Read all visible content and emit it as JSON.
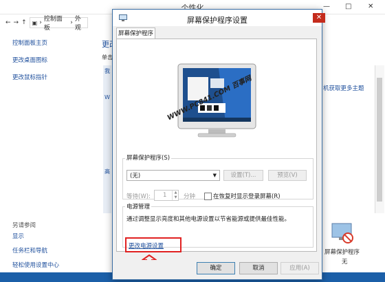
{
  "background_window": {
    "title": "个性化",
    "controls": {
      "minimize": "—",
      "maximize": "□",
      "close": "✕"
    },
    "address": [
      "控制面板",
      "外观"
    ],
    "sidebar": {
      "items": [
        "控制面板主页",
        "更改桌面图标",
        "更改鼠标指针"
      ],
      "see_also_heading": "另请参阅",
      "see_also": [
        "显示",
        "任务栏和导航",
        "轻松使用设置中心"
      ]
    },
    "main_heading_partial": "更改",
    "main_sub_partial": "单击",
    "partial_letters": [
      "我",
      "W",
      "高"
    ],
    "right_link": "机获取更多主题",
    "bottom_item": {
      "label": "屏幕保护程序",
      "sub": "无"
    }
  },
  "dialog": {
    "title": "屏幕保护程序设置",
    "close_glyph": "✕",
    "tab": "屏幕保护程序",
    "preview_watermark": "WWW.PC841.COM 百事网",
    "screensaver": {
      "group_label": "屏幕保护程序(S)",
      "selected": "(无)",
      "settings_button": "设置(T)...",
      "preview_button": "预览(V)",
      "wait_label": "等待(W):",
      "wait_value": "1",
      "unit": "分钟",
      "resume_checkbox_label": "在恢复时显示登录屏幕(R)"
    },
    "power": {
      "group_label": "电源管理",
      "description": "通过调整显示亮度和其他电源设置以节省能源或提供最佳性能。",
      "link": "更改电源设置"
    },
    "buttons": {
      "ok": "确定",
      "cancel": "取消",
      "apply": "应用(A)"
    }
  },
  "colors": {
    "accent": "#1e4f9c",
    "highlight_red": "#e02020",
    "dialog_close": "#c42b1c"
  }
}
